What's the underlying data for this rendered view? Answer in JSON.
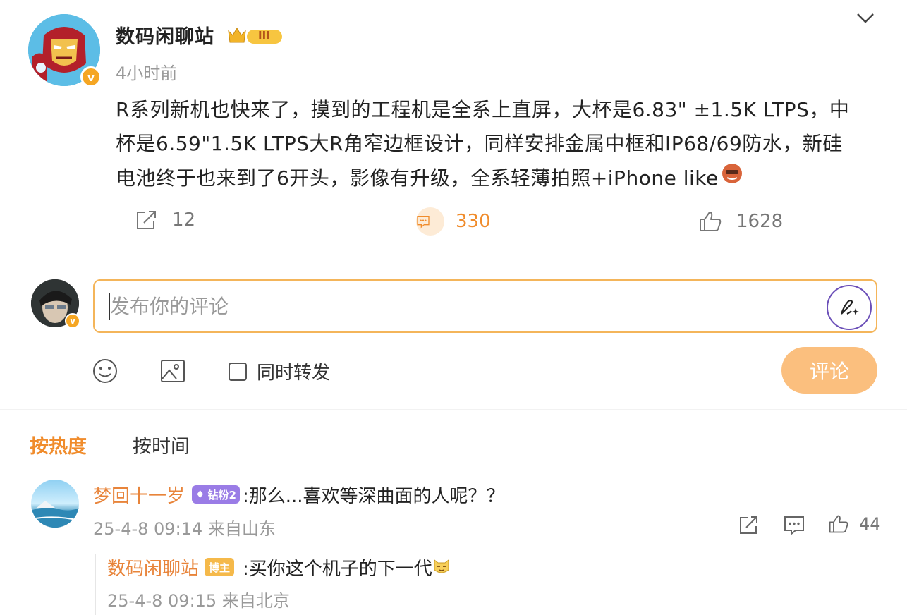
{
  "post": {
    "author": "数码闲聊站",
    "level_badge": "III",
    "time": "4小时前",
    "verified_mark": "v",
    "text_lines": [
      "R系列新机也快来了，摸到的工程机是全系上直屏，大杯是6.83\" ±1.5K LTPS，中",
      "杯是6.59\"1.5K LTPS大R角窄边框设计，同样安排金属中框和IP68/69防水，新硅",
      "电池终于也来到了6开头，影像有升级，全系轻薄拍照+iPhone like"
    ],
    "stats": {
      "reposts": "12",
      "comments": "330",
      "likes": "1628"
    }
  },
  "composer": {
    "placeholder": "发布你的评论",
    "sync_repost_label": "同时转发",
    "submit_label": "评论"
  },
  "sort_tabs": {
    "hot": "按热度",
    "time": "按时间"
  },
  "comment": {
    "user": "梦回十一岁",
    "badge": "钻粉2",
    "text": ":那么...喜欢等深曲面的人呢？？",
    "meta": "25-4-8 09:14 来自山东",
    "likes": "44",
    "reply": {
      "user": "数码闲聊站",
      "badge": "博主",
      "text": ":买你这个机子的下一代",
      "meta": "25-4-8 09:15 来自北京"
    }
  },
  "icons": {
    "chevron": "chevron-down-icon",
    "repost": "share-icon",
    "comment": "comment-icon",
    "like": "thumbs-up-icon",
    "pen": "pen-sparkle-icon",
    "emoji": "smiley-icon",
    "image": "image-icon"
  },
  "colors": {
    "accent": "#f08c2c",
    "username": "#e8843a",
    "composer_border": "#f4b55a",
    "submit_bg": "#fbbf7e",
    "verified": "#f5a623",
    "diamond_badge": "#9a7ce6"
  }
}
